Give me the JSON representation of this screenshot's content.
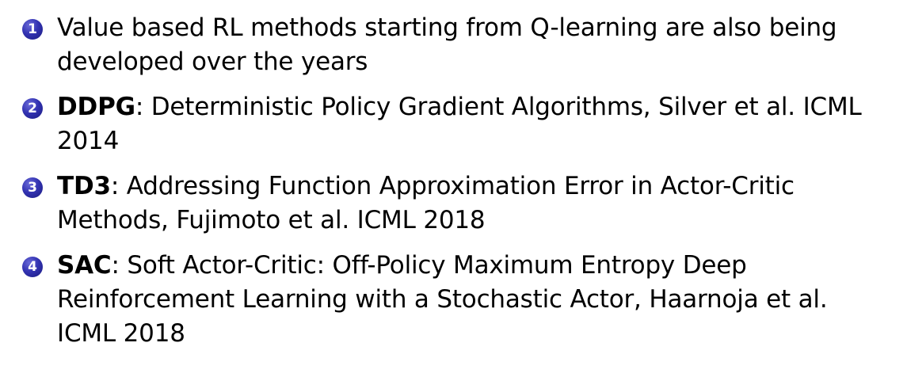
{
  "bullet_color": "#3333b2",
  "items": [
    {
      "number": "1",
      "acronym": "",
      "text": "Value based RL methods starting from Q-learning are also being developed over the years"
    },
    {
      "number": "2",
      "acronym": "DDPG",
      "text": ": Deterministic Policy Gradient Algorithms, Silver et al. ICML 2014"
    },
    {
      "number": "3",
      "acronym": "TD3",
      "text": ": Addressing Function Approximation Error in Actor-Critic Methods, Fujimoto et al. ICML 2018"
    },
    {
      "number": "4",
      "acronym": "SAC",
      "text": ": Soft Actor-Critic: Off-Policy Maximum Entropy Deep Reinforcement Learning with a Stochastic Actor, Haarnoja et al. ICML 2018"
    }
  ]
}
